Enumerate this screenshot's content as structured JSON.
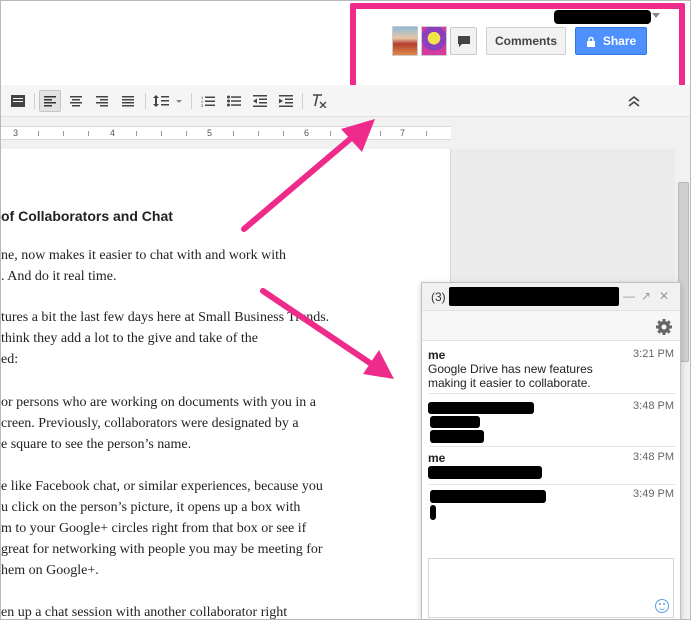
{
  "header": {
    "comments_label": "Comments",
    "share_label": "Share",
    "avatars": [
      "avatar-collaborator-1",
      "avatar-collaborator-2"
    ],
    "share_color": "#4d90fe",
    "highlight_color": "#ee2b8a"
  },
  "toolbar": {
    "icons": [
      "comment-icon",
      "align-left-icon",
      "align-center-icon",
      "align-right-icon",
      "justify-icon",
      "line-spacing-icon",
      "numbered-list-icon",
      "bulleted-list-icon",
      "decrease-indent-icon",
      "increase-indent-icon",
      "clear-formatting-icon",
      "collapse-icon"
    ]
  },
  "ruler": {
    "numbers": [
      "3",
      "4",
      "5",
      "6",
      "7"
    ]
  },
  "document": {
    "title": "of Collaborators and Chat",
    "lines": [
      "ne, now makes it easier  to chat with and work with",
      ". And do it real time.",
      "tures a bit the last few days here at Small Business Trends.",
      "think they add a lot to the give and take of the",
      "ed:",
      "or persons who are working on  documents with you in a",
      "creen. Previously, collaborators were designated by a",
      "e square to see the person’s name.",
      "e like Facebook chat, or similar experiences, because you",
      "u click on the person’s picture, it opens up a box with",
      "m to your Google+ circles right from that box or see if",
      "great for networking with people you may be meeting for",
      "hem on Google+.",
      "en up a chat session with another collaborator right"
    ]
  },
  "chat": {
    "count": "(3)",
    "messages": [
      {
        "name": "me",
        "time": "3:21 PM",
        "text": "Google Drive has new features making it easier to collaborate."
      },
      {
        "name": "",
        "time": "3:48 PM",
        "text": ""
      },
      {
        "name": "me",
        "time": "3:48 PM",
        "text": ""
      },
      {
        "name": "",
        "time": "3:49 PM",
        "text": ""
      }
    ]
  }
}
